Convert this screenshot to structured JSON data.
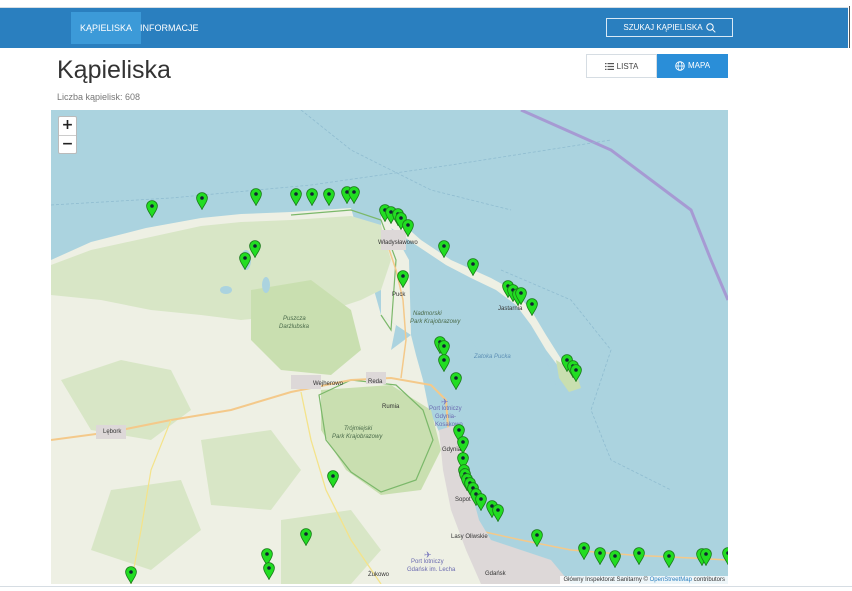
{
  "nav": {
    "items": [
      {
        "label": "KĄPIELISKA"
      },
      {
        "label": "INFORMACJE"
      }
    ],
    "search_label": "SZUKAJ KĄPIELISKA"
  },
  "page": {
    "title": "Kąpieliska",
    "count_text": "Liczba kąpielisk: 608"
  },
  "view_toggle": {
    "lista_label": "LISTA",
    "mapa_label": "MAPA"
  },
  "map": {
    "zoom_in": "+",
    "zoom_out": "−",
    "attribution_prefix": "Główny Inspektorat Sanitarny © ",
    "attribution_link": "OpenStreetMap",
    "attribution_suffix": " contributors",
    "places": {
      "wladyslawowo": "Władysławowo",
      "puck": "Puck",
      "jastarnia": "Jastarnia",
      "nadmorski": "Nadmorski",
      "nadmorski2": "Park Krajobrazowy",
      "zatoka": "Zatoka Pucka",
      "puszcza": "Puszcza",
      "puszcza2": "Darżlubska",
      "wejherowo": "Wejherowo",
      "reda": "Reda",
      "rumia": "Rumia",
      "lebork": "Lębork",
      "trojmiejski": "Trójmiejski",
      "trojmiejski2": "Park Krajobrazowy",
      "lotnisko": "Port lotniczy",
      "lotnisko2": "Gdynia-",
      "lotnisko3": "Kosakowo",
      "gdynia": "Gdynia",
      "sopot": "Sopot",
      "gdansk": "Gdańsk",
      "zukowo": "Żukowo",
      "lasy": "Lasy Oliwskie",
      "lotnisko_gd": "Port lotniczy",
      "lotnisko_gd2": "Gdańsk im. Lecha"
    },
    "marker_color": "#22dd22",
    "land_color": "#eef0e4",
    "sea_color": "#abd3df",
    "forest_color": "#c9dfb0"
  }
}
